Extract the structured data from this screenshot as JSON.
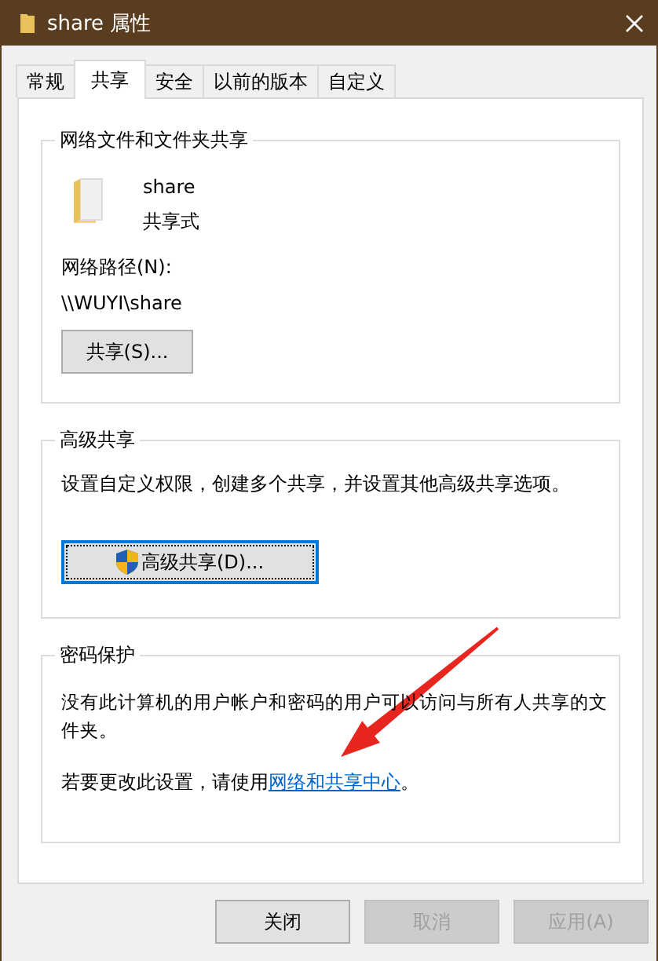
{
  "window": {
    "title": "share 属性"
  },
  "tabs": [
    {
      "label": "常规",
      "selected": false
    },
    {
      "label": "共享",
      "selected": true
    },
    {
      "label": "安全",
      "selected": false
    },
    {
      "label": "以前的版本",
      "selected": false
    },
    {
      "label": "自定义",
      "selected": false
    }
  ],
  "sharing": {
    "title": "网络文件和文件夹共享",
    "folder_name": "share",
    "share_status": "共享式",
    "path_label": "网络路径(N):",
    "path": "\\\\WUYI\\share",
    "button": "共享(S)..."
  },
  "advanced": {
    "title": "高级共享",
    "description": "设置自定义权限，创建多个共享，并设置其他高级共享选项。",
    "button": "高级共享(D)...",
    "focused": true
  },
  "password": {
    "title": "密码保护",
    "description": "没有此计算机的用户帐户和密码的用户可以访问与所有人共享的文件夹。",
    "hint": "若要更改此设置，请使用",
    "link": "网络和共享中心",
    "hint_end": "。"
  },
  "buttons": [
    {
      "label": "关闭",
      "disabled": false
    },
    {
      "label": "取消",
      "disabled": true
    },
    {
      "label": "应用(A)",
      "disabled": true
    }
  ],
  "annotations": [
    {
      "kind": "arrow"
    }
  ]
}
